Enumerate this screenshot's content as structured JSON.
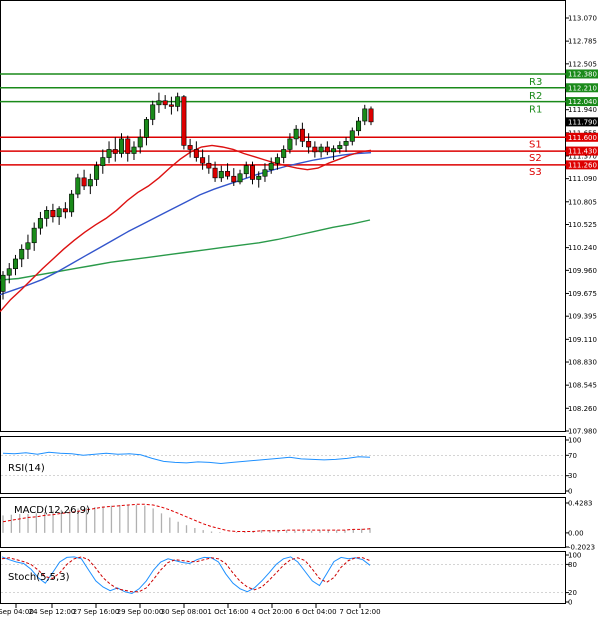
{
  "chart_data": [
    {
      "type": "candlestick",
      "panel": "price",
      "yticks": [
        "113.070",
        "112.785",
        "112.505",
        "112.220",
        "111.940",
        "111.655",
        "111.370",
        "111.090",
        "110.805",
        "110.525",
        "110.240",
        "109.960",
        "109.675",
        "109.395",
        "109.110",
        "108.830",
        "108.545",
        "108.260",
        "107.980"
      ],
      "xticks": [
        "Sep 04:00",
        "24 Sep 12:00",
        "27 Sep 16:00",
        "29 Sep 00:00",
        "30 Sep 08:00",
        "1 Oct 16:00",
        "4 Oct 20:00",
        "6 Oct 04:00",
        "7 Oct 12:00"
      ],
      "levels": [
        {
          "name": "R3",
          "value": 112.38,
          "tag": "112.380",
          "color": "#1a8a1a"
        },
        {
          "name": "R2",
          "value": 112.21,
          "tag": "112.210",
          "color": "#1a8a1a"
        },
        {
          "name": "R1",
          "value": 112.04,
          "tag": "112.040",
          "color": "#1a8a1a"
        },
        {
          "name": "S1",
          "value": 111.6,
          "tag": "111.600",
          "color": "#dd0000"
        },
        {
          "name": "S2",
          "value": 111.43,
          "tag": "111.430",
          "color": "#dd0000"
        },
        {
          "name": "S3",
          "value": 111.26,
          "tag": "111.260",
          "color": "#dd0000"
        }
      ],
      "current_price": {
        "value": 111.79,
        "tag": "111.790"
      },
      "ohlc": [
        [
          109.7,
          109.95,
          109.6,
          109.9
        ],
        [
          109.9,
          110.05,
          109.8,
          109.98
        ],
        [
          109.98,
          110.15,
          109.9,
          110.1
        ],
        [
          110.1,
          110.28,
          110.0,
          110.22
        ],
        [
          110.22,
          110.4,
          110.1,
          110.3
        ],
        [
          110.3,
          110.55,
          110.2,
          110.48
        ],
        [
          110.48,
          110.68,
          110.4,
          110.6
        ],
        [
          110.6,
          110.75,
          110.5,
          110.7
        ],
        [
          110.7,
          110.78,
          110.55,
          110.62
        ],
        [
          110.62,
          110.75,
          110.52,
          110.72
        ],
        [
          110.72,
          110.8,
          110.6,
          110.68
        ],
        [
          110.68,
          110.95,
          110.62,
          110.9
        ],
        [
          110.9,
          111.15,
          110.85,
          111.1
        ],
        [
          111.1,
          111.2,
          110.95,
          111.0
        ],
        [
          111.0,
          111.15,
          110.9,
          111.08
        ],
        [
          111.08,
          111.3,
          111.0,
          111.25
        ],
        [
          111.25,
          111.45,
          111.15,
          111.35
        ],
        [
          111.35,
          111.55,
          111.28,
          111.45
        ],
        [
          111.45,
          111.6,
          111.3,
          111.4
        ],
        [
          111.4,
          111.65,
          111.35,
          111.58
        ],
        [
          111.58,
          111.62,
          111.3,
          111.4
        ],
        [
          111.4,
          111.55,
          111.32,
          111.48
        ],
        [
          111.48,
          111.7,
          111.4,
          111.6
        ],
        [
          111.6,
          111.85,
          111.5,
          111.82
        ],
        [
          111.82,
          112.05,
          111.75,
          112.0
        ],
        [
          112.0,
          112.15,
          111.9,
          112.05
        ],
        [
          112.05,
          112.12,
          111.95,
          112.0
        ],
        [
          112.0,
          112.1,
          111.88,
          111.98
        ],
        [
          111.98,
          112.15,
          111.92,
          112.1
        ],
        [
          112.1,
          112.12,
          111.45,
          111.5
        ],
        [
          111.5,
          111.58,
          111.35,
          111.45
        ],
        [
          111.45,
          111.55,
          111.3,
          111.35
        ],
        [
          111.35,
          111.45,
          111.2,
          111.28
        ],
        [
          111.28,
          111.38,
          111.15,
          111.22
        ],
        [
          111.22,
          111.3,
          111.05,
          111.1
        ],
        [
          111.1,
          111.25,
          111.05,
          111.18
        ],
        [
          111.18,
          111.28,
          111.08,
          111.12
        ],
        [
          111.12,
          111.22,
          111.0,
          111.05
        ],
        [
          111.05,
          111.2,
          111.02,
          111.15
        ],
        [
          111.15,
          111.3,
          111.1,
          111.25
        ],
        [
          111.25,
          111.3,
          111.02,
          111.08
        ],
        [
          111.08,
          111.18,
          110.98,
          111.12
        ],
        [
          111.12,
          111.28,
          111.05,
          111.2
        ],
        [
          111.2,
          111.35,
          111.15,
          111.28
        ],
        [
          111.28,
          111.4,
          111.2,
          111.35
        ],
        [
          111.35,
          111.5,
          111.28,
          111.45
        ],
        [
          111.45,
          111.65,
          111.4,
          111.58
        ],
        [
          111.58,
          111.75,
          111.5,
          111.7
        ],
        [
          111.7,
          111.78,
          111.48,
          111.55
        ],
        [
          111.55,
          111.65,
          111.4,
          111.48
        ],
        [
          111.48,
          111.55,
          111.35,
          111.42
        ],
        [
          111.42,
          111.52,
          111.35,
          111.48
        ],
        [
          111.48,
          111.55,
          111.38,
          111.42
        ],
        [
          111.42,
          111.5,
          111.32,
          111.46
        ],
        [
          111.46,
          111.55,
          111.4,
          111.5
        ],
        [
          111.5,
          111.6,
          111.42,
          111.55
        ],
        [
          111.55,
          111.72,
          111.5,
          111.68
        ],
        [
          111.68,
          111.85,
          111.62,
          111.8
        ],
        [
          111.8,
          112.0,
          111.75,
          111.95
        ],
        [
          111.95,
          111.98,
          111.75,
          111.79
        ]
      ],
      "ma_red": [
        109.45,
        109.6,
        109.72,
        109.85,
        109.98,
        110.1,
        110.22,
        110.33,
        110.43,
        110.52,
        110.6,
        110.7,
        110.82,
        110.92,
        111.0,
        111.1,
        111.22,
        111.33,
        111.42,
        111.48,
        111.5,
        111.48,
        111.45,
        111.4,
        111.36,
        111.32,
        111.28,
        111.25,
        111.22,
        111.2,
        111.22,
        111.28,
        111.33,
        111.38,
        111.42,
        111.44
      ],
      "ma_blue": [
        109.66,
        109.72,
        109.78,
        109.85,
        109.94,
        110.04,
        110.14,
        110.24,
        110.34,
        110.44,
        110.53,
        110.62,
        110.71,
        110.8,
        110.89,
        110.96,
        111.02,
        111.08,
        111.14,
        111.19,
        111.24,
        111.28,
        111.32,
        111.35,
        111.38,
        111.4,
        111.41
      ],
      "ma_green": [
        109.84,
        109.86,
        109.9,
        109.94,
        109.98,
        110.02,
        110.06,
        110.09,
        110.12,
        110.15,
        110.18,
        110.21,
        110.24,
        110.27,
        110.3,
        110.34,
        110.39,
        110.44,
        110.49,
        110.53,
        110.58
      ]
    },
    {
      "type": "line",
      "panel": "indicator",
      "title": "RSI(14)",
      "yticks": [
        "100",
        "70",
        "30",
        "0"
      ],
      "values": [
        74,
        73,
        75,
        72,
        76,
        74,
        73,
        70,
        72,
        74,
        72,
        73,
        71,
        64,
        58,
        56,
        55,
        57,
        56,
        54,
        56,
        58,
        60,
        62,
        64,
        66,
        63,
        62,
        61,
        62,
        64,
        67,
        66
      ]
    },
    {
      "type": "bar",
      "panel": "indicator",
      "title": "MACD(12,26,9)",
      "yticks": [
        "0.4283",
        "0.00",
        "-0.2023"
      ],
      "values": [
        0.25,
        0.26,
        0.27,
        0.27,
        0.28,
        0.3,
        0.32,
        0.33,
        0.33,
        0.35,
        0.36,
        0.37,
        0.38,
        0.39,
        0.4,
        0.4,
        0.4,
        0.39,
        0.35,
        0.28,
        0.22,
        0.16,
        0.11,
        0.07,
        0.04,
        0.02,
        0.01,
        0.0,
        0.01,
        0.02,
        0.03,
        0.04,
        0.04,
        0.04,
        0.04,
        0.03,
        0.03,
        0.03,
        0.04,
        0.04,
        0.04,
        0.04,
        0.05,
        0.06,
        0.07
      ],
      "signal": [
        0.16,
        0.18,
        0.2,
        0.22,
        0.23,
        0.25,
        0.26,
        0.28,
        0.29,
        0.31,
        0.33,
        0.35,
        0.37,
        0.38,
        0.39,
        0.4,
        0.41,
        0.41,
        0.4,
        0.37,
        0.33,
        0.28,
        0.23,
        0.18,
        0.13,
        0.09,
        0.06,
        0.03,
        0.02,
        0.02,
        0.02,
        0.03,
        0.03,
        0.03,
        0.04,
        0.04,
        0.04,
        0.04,
        0.04,
        0.04,
        0.04,
        0.04,
        0.05,
        0.05,
        0.06
      ]
    },
    {
      "type": "line",
      "panel": "indicator",
      "title": "Stoch(5,5,3)",
      "yticks": [
        "100",
        "80",
        "20",
        "0"
      ],
      "series": [
        {
          "color": "#1e90ff",
          "values": [
            96,
            90,
            85,
            82,
            70,
            52,
            40,
            62,
            85,
            95,
            96,
            92,
            68,
            45,
            32,
            24,
            30,
            22,
            18,
            28,
            45,
            68,
            85,
            92,
            88,
            84,
            82,
            90,
            95,
            94,
            85,
            60,
            40,
            28,
            22,
            30,
            45,
            62,
            80,
            92,
            96,
            85,
            65,
            45,
            35,
            60,
            86,
            95,
            92,
            94,
            90,
            78
          ]
        },
        {
          "color": "#cc0000",
          "values": [
            92,
            94,
            90,
            86,
            80,
            68,
            54,
            50,
            62,
            80,
            92,
            96,
            90,
            72,
            52,
            38,
            28,
            25,
            22,
            22,
            30,
            48,
            68,
            84,
            90,
            88,
            86,
            86,
            90,
            94,
            92,
            82,
            62,
            44,
            32,
            26,
            32,
            46,
            62,
            78,
            90,
            94,
            88,
            70,
            50,
            42,
            52,
            74,
            88,
            94,
            94,
            88
          ]
        }
      ],
      "ylim": [
        0,
        100
      ]
    }
  ]
}
